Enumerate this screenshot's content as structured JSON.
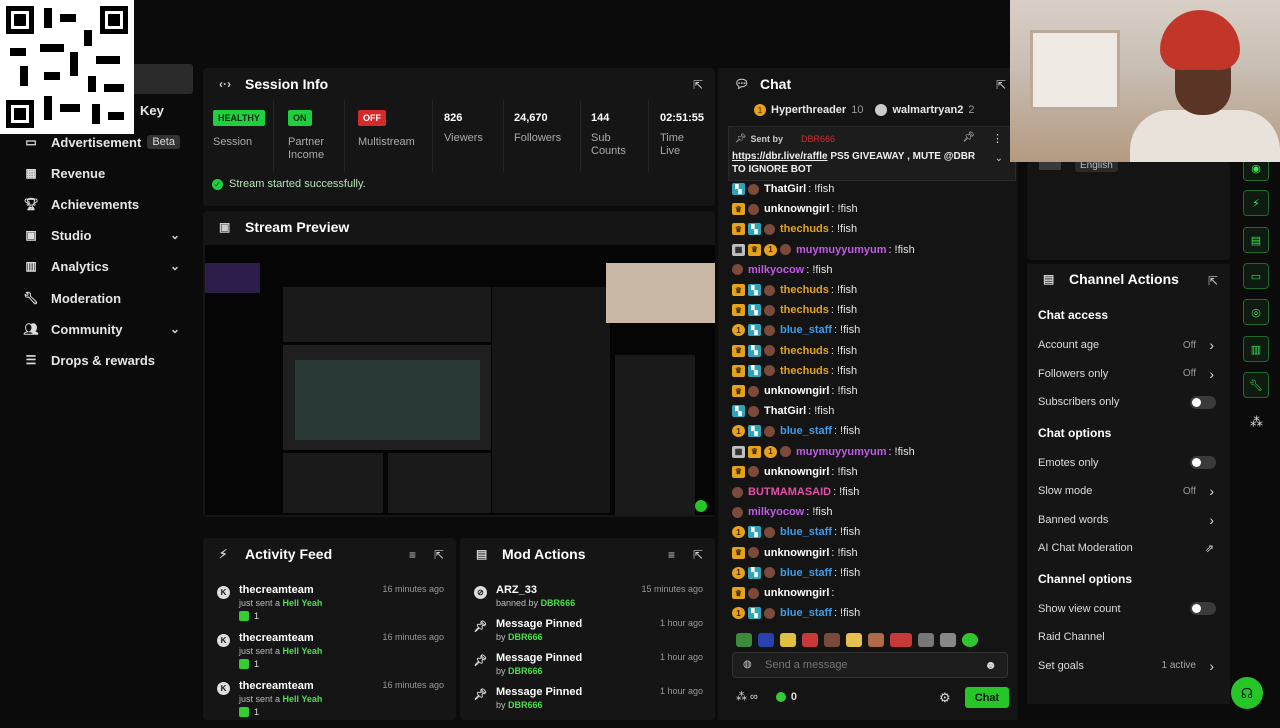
{
  "sidebar": {
    "partial_item": "Key",
    "items": [
      {
        "label": "Advertisement",
        "badge": "Beta",
        "icon": "ad-icon"
      },
      {
        "label": "Revenue",
        "icon": "revenue-icon"
      },
      {
        "label": "Achievements",
        "icon": "trophy-icon"
      },
      {
        "label": "Studio",
        "icon": "studio-icon"
      },
      {
        "label": "Analytics",
        "icon": "analytics-icon"
      },
      {
        "label": "Moderation",
        "icon": "wrench-icon"
      },
      {
        "label": "Community",
        "icon": "community-icon"
      },
      {
        "label": "Drops & rewards",
        "icon": "drops-icon"
      }
    ]
  },
  "session": {
    "title": "Session Info",
    "stats": [
      {
        "value": "HEALTHY",
        "label": "Session",
        "badge": "green"
      },
      {
        "value": "ON",
        "label": "Partner Income",
        "badge": "green"
      },
      {
        "value": "OFF",
        "label": "Multistream",
        "badge": "red"
      },
      {
        "value": "826",
        "label": "Viewers"
      },
      {
        "value": "24,670",
        "label": "Followers"
      },
      {
        "value": "144",
        "label": "Sub Counts"
      },
      {
        "value": "02:51:55",
        "label": "Time Live"
      }
    ],
    "success_message": "Stream started successfully."
  },
  "preview": {
    "title": "Stream Preview"
  },
  "activity": {
    "title": "Activity Feed",
    "rows": [
      {
        "user": "thecreamteam",
        "action": "just sent a",
        "item": "Hell Yeah",
        "count": "1",
        "time": "16 minutes ago"
      },
      {
        "user": "thecreamteam",
        "action": "just sent a",
        "item": "Hell Yeah",
        "count": "1",
        "time": "16 minutes ago"
      },
      {
        "user": "thecreamteam",
        "action": "just sent a",
        "item": "Hell Yeah",
        "count": "1",
        "time": "16 minutes ago"
      }
    ]
  },
  "mod": {
    "title": "Mod Actions",
    "rows": [
      {
        "action": "ARZ_33",
        "verb": "banned by",
        "by": "DBR666",
        "time": "15 minutes ago"
      },
      {
        "action": "Message Pinned",
        "verb": "by",
        "by": "DBR666",
        "time": "1 hour ago"
      },
      {
        "action": "Message Pinned",
        "verb": "by",
        "by": "DBR666",
        "time": "1 hour ago"
      },
      {
        "action": "Message Pinned",
        "verb": "by",
        "by": "DBR666",
        "time": "1 hour ago"
      }
    ]
  },
  "chat": {
    "title": "Chat",
    "top_gifters": [
      {
        "name": "Hyperthreader",
        "count": "10"
      },
      {
        "name": "walmartryan2",
        "count": "2"
      }
    ],
    "pinned": {
      "sent_by_label": "Sent by",
      "sender": "DBR666",
      "link": "https://dbr.live/raffle",
      "text": "PS5 GIVEAWAY , MUTE @DBR TO IGNORE BOT"
    },
    "messages": [
      {
        "user": "ThatGirl",
        "text": "!fish",
        "color": "#ffffff",
        "badges": [
          "sub"
        ]
      },
      {
        "user": "unknowngirl",
        "text": "!fish",
        "color": "#ffffff",
        "badges": [
          "crown"
        ]
      },
      {
        "user": "thechuds",
        "text": "!fish",
        "color": "#e5a31a",
        "badges": [
          "crown",
          "sub"
        ]
      },
      {
        "user": "muymuyyumyum",
        "text": "!fish",
        "color": "#c15be6",
        "badges": [
          "gift",
          "crown",
          "coin"
        ]
      },
      {
        "user": "milkyocow",
        "text": "!fish",
        "color": "#c15be6",
        "badges": []
      },
      {
        "user": "thechuds",
        "text": "!fish",
        "color": "#e5a31a",
        "badges": [
          "crown",
          "sub"
        ]
      },
      {
        "user": "thechuds",
        "text": "!fish",
        "color": "#e5a31a",
        "badges": [
          "crown",
          "sub"
        ]
      },
      {
        "user": "blue_staff",
        "text": "!fish",
        "color": "#3e9be8",
        "badges": [
          "coin",
          "sub"
        ]
      },
      {
        "user": "thechuds",
        "text": "!fish",
        "color": "#e5a31a",
        "badges": [
          "crown",
          "sub"
        ]
      },
      {
        "user": "thechuds",
        "text": "!fish",
        "color": "#e5a31a",
        "badges": [
          "crown",
          "sub"
        ]
      },
      {
        "user": "unknowngirl",
        "text": "!fish",
        "color": "#ffffff",
        "badges": [
          "crown"
        ]
      },
      {
        "user": "ThatGirl",
        "text": "!fish",
        "color": "#ffffff",
        "badges": [
          "sub"
        ]
      },
      {
        "user": "blue_staff",
        "text": "!fish",
        "color": "#3e9be8",
        "badges": [
          "coin",
          "sub"
        ]
      },
      {
        "user": "muymuyyumyum",
        "text": "!fish",
        "color": "#c15be6",
        "badges": [
          "gift",
          "crown",
          "coin"
        ]
      },
      {
        "user": "unknowngirl",
        "text": "!fish",
        "color": "#ffffff",
        "badges": [
          "crown"
        ]
      },
      {
        "user": "BUTMAMASAID",
        "text": "!fish",
        "color": "#e64fa8",
        "badges": []
      },
      {
        "user": "milkyocow",
        "text": "!fish",
        "color": "#c15be6",
        "badges": []
      },
      {
        "user": "blue_staff",
        "text": "!fish",
        "color": "#3e9be8",
        "badges": [
          "coin",
          "sub"
        ]
      },
      {
        "user": "unknowngirl",
        "text": "!fish",
        "color": "#ffffff",
        "badges": [
          "crown"
        ]
      },
      {
        "user": "blue_staff",
        "text": "!fish",
        "color": "#3e9be8",
        "badges": [
          "coin",
          "sub"
        ]
      },
      {
        "user": "unknowngirl",
        "text": "",
        "color": "#ffffff",
        "badges": [
          "crown"
        ]
      },
      {
        "user": "blue_staff",
        "text": "!fish",
        "color": "#3e9be8",
        "badges": [
          "coin",
          "sub"
        ]
      }
    ],
    "input_placeholder": "Send a message",
    "viewer_count": "0",
    "send_label": "Chat"
  },
  "channel_actions": {
    "title": "Channel Actions",
    "language": "English",
    "sections": [
      {
        "title": "Chat access",
        "rows": [
          {
            "label": "Account age",
            "value": "Off",
            "control": "arrow"
          },
          {
            "label": "Followers only",
            "value": "Off",
            "control": "arrow"
          },
          {
            "label": "Subscribers only",
            "value": "",
            "control": "toggle"
          }
        ]
      },
      {
        "title": "Chat options",
        "rows": [
          {
            "label": "Emotes only",
            "value": "",
            "control": "toggle"
          },
          {
            "label": "Slow mode",
            "value": "Off",
            "control": "arrow"
          },
          {
            "label": "Banned words",
            "value": "",
            "control": "arrow"
          },
          {
            "label": "AI Chat Moderation",
            "value": "",
            "control": "external"
          }
        ]
      },
      {
        "title": "Channel options",
        "rows": [
          {
            "label": "Show view count",
            "value": "",
            "control": "toggle"
          },
          {
            "label": "Raid Channel",
            "value": "",
            "control": "none"
          },
          {
            "label": "Set goals",
            "value": "1 active",
            "control": "arrow"
          }
        ]
      }
    ]
  },
  "colors": {
    "accent": "#26c628",
    "danger": "#d42a2a",
    "panel": "#151515"
  }
}
